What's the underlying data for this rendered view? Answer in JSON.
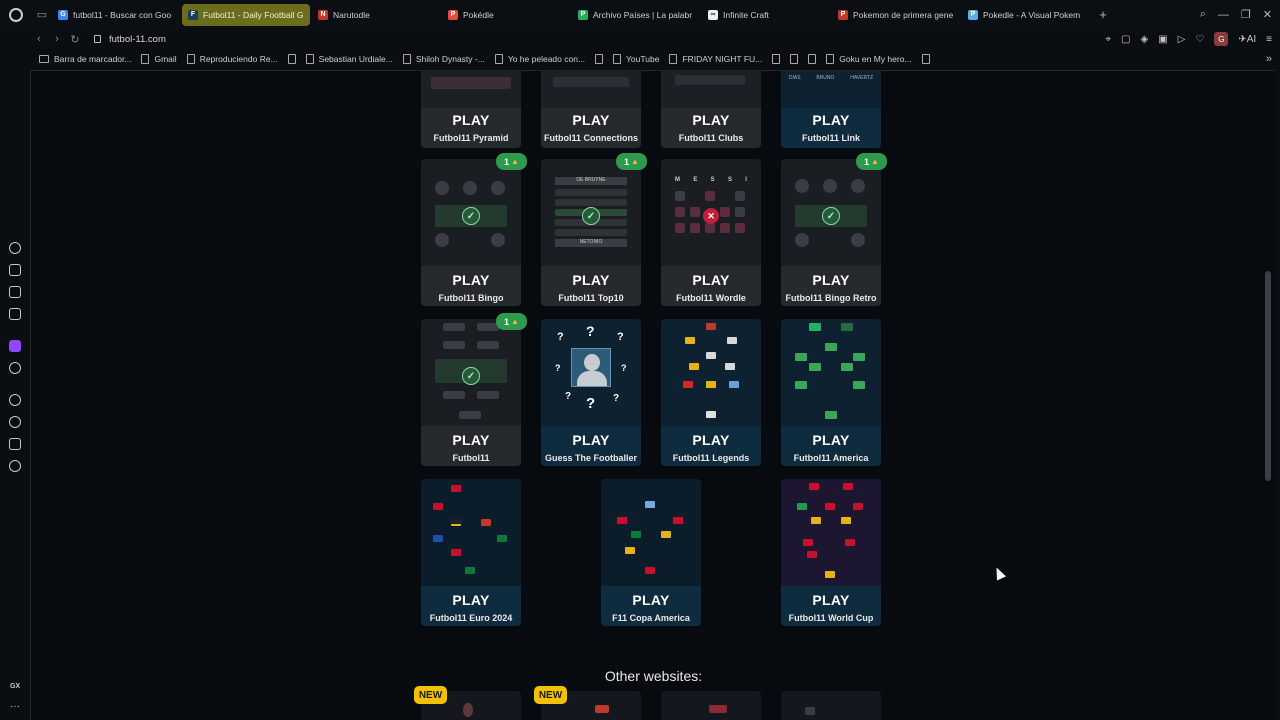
{
  "browser": {
    "tabs": [
      {
        "title": "futbol11 - Buscar con Goo",
        "color": "#4285f4",
        "glyph": "G"
      },
      {
        "title": "Futbol11 - Daily Football G",
        "color": "#1d3c58",
        "glyph": "F",
        "active": true
      },
      {
        "title": "Narutodle",
        "color": "#c0392b",
        "glyph": "N"
      },
      {
        "title": "Pokédle",
        "color": "#e74c3c",
        "glyph": "P"
      },
      {
        "title": "Archivo Países | La palabr",
        "color": "#27ae60",
        "glyph": "P"
      },
      {
        "title": "Infinite Craft",
        "color": "#ecf0f1",
        "glyph": "∞"
      },
      {
        "title": "Pokemon de primera gene",
        "color": "#c0392b",
        "glyph": "P"
      },
      {
        "title": "Pokedle - A Visual Pokem",
        "color": "#5dade2",
        "glyph": "P"
      }
    ],
    "url": "futbol-11.com",
    "profile_initial": "G",
    "ai_label": "AI",
    "bookmarks": [
      {
        "label": "Barra de marcador...",
        "kind": "folder"
      },
      {
        "label": "Gmail",
        "kind": "page"
      },
      {
        "label": "Reproduciendo Re...",
        "kind": "page"
      },
      {
        "label": "",
        "kind": "page"
      },
      {
        "label": "Sebastian Urdiale...",
        "kind": "page"
      },
      {
        "label": "Shiloh Dynasty -...",
        "kind": "page"
      },
      {
        "label": "Yo he peleado con...",
        "kind": "page"
      },
      {
        "label": "",
        "kind": "page"
      },
      {
        "label": "YouTube",
        "kind": "page"
      },
      {
        "label": "FRIDAY NIGHT FU...",
        "kind": "page"
      },
      {
        "label": "",
        "kind": "page"
      },
      {
        "label": "",
        "kind": "page"
      },
      {
        "label": "",
        "kind": "page"
      },
      {
        "label": "Goku en My hero...",
        "kind": "page"
      },
      {
        "label": "",
        "kind": "page"
      }
    ],
    "sidebar_gx": "GX"
  },
  "page": {
    "play_label": "PLAY",
    "top_row": [
      {
        "name": "Futbol11 Pyramid"
      },
      {
        "name": "Futbol11 Connections"
      },
      {
        "name": "Futbol11 Clubs"
      },
      {
        "name": "Futbol11 Link",
        "link_names": [
          "DIAS",
          "BRUNO",
          "HAVERTZ"
        ]
      }
    ],
    "row2": [
      {
        "name": "Futbol11 Bingo",
        "badge": "1",
        "state": "check"
      },
      {
        "name": "Futbol11 Top10",
        "badge": "1",
        "state": "check",
        "top_label": "DE BRUYNE",
        "bottom_label": "NETONIO"
      },
      {
        "name": "Futbol11 Wordle",
        "state": "cross",
        "letters": [
          "M",
          "E",
          "S",
          "S",
          "I"
        ]
      },
      {
        "name": "Futbol11 Bingo Retro",
        "badge": "1",
        "state": "check"
      }
    ],
    "row3": [
      {
        "name": "Futbol11",
        "badge": "1",
        "state": "check"
      },
      {
        "name": "Guess The Footballer"
      },
      {
        "name": "Futbol11 Legends"
      },
      {
        "name": "Futbol11 America"
      }
    ],
    "row4": [
      {
        "name": "Futbol11 Euro 2024"
      },
      {
        "name": "F11 Copa America"
      },
      {
        "name": "Futbol11 World Cup"
      }
    ],
    "other_title": "Other websites:",
    "new_label": "NEW"
  },
  "colors": {
    "accent_tab": "#6a6d1d",
    "badge_green": "#2e9a4d",
    "new_yellow": "#f2c200",
    "card_blue": "#0f2b3e",
    "card_grey": "#26292e"
  }
}
